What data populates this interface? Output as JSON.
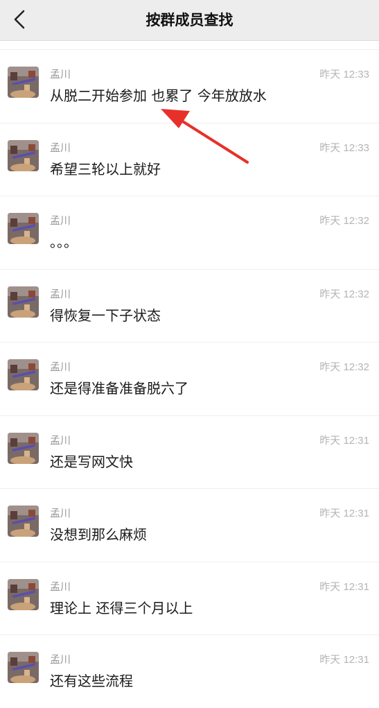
{
  "header": {
    "title": "按群成员查找",
    "back_icon": "chevron-left-icon"
  },
  "messages": [
    {
      "sender": "孟川",
      "time": "昨天 12:33",
      "text": "从脱二开始参加 也累了 今年放放水"
    },
    {
      "sender": "孟川",
      "time": "昨天 12:33",
      "text": "希望三轮以上就好"
    },
    {
      "sender": "孟川",
      "time": "昨天 12:32",
      "text": "。。。"
    },
    {
      "sender": "孟川",
      "time": "昨天 12:32",
      "text": "得恢复一下子状态"
    },
    {
      "sender": "孟川",
      "time": "昨天 12:32",
      "text": "还是得准备准备脱六了"
    },
    {
      "sender": "孟川",
      "time": "昨天 12:31",
      "text": "还是写网文快"
    },
    {
      "sender": "孟川",
      "time": "昨天 12:31",
      "text": "没想到那么麻烦"
    },
    {
      "sender": "孟川",
      "time": "昨天 12:31",
      "text": "理论上 还得三个月以上"
    },
    {
      "sender": "孟川",
      "time": "昨天 12:31",
      "text": "还有这些流程"
    }
  ],
  "annotation": {
    "icon": "red-arrow-icon",
    "color": "#e8302a"
  }
}
